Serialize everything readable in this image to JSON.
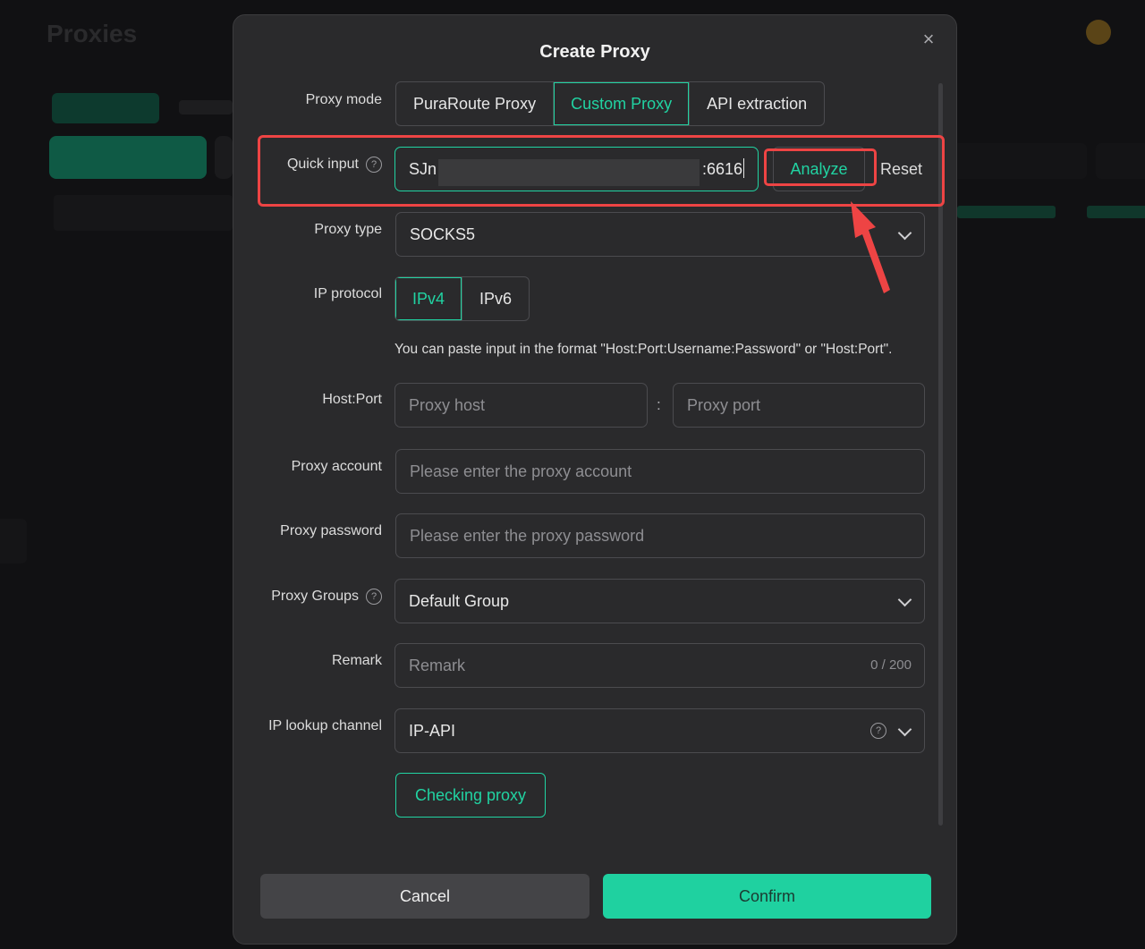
{
  "background": {
    "page_title": "Proxies"
  },
  "dialog": {
    "title": "Create Proxy",
    "proxy_mode": {
      "label": "Proxy mode",
      "options": [
        "PuraRoute Proxy",
        "Custom Proxy",
        "API extraction"
      ],
      "selected": "Custom Proxy"
    },
    "quick_input": {
      "label": "Quick input",
      "value_start": "SJn",
      "value_end": ":6616",
      "analyze_label": "Analyze",
      "reset_label": "Reset"
    },
    "proxy_type": {
      "label": "Proxy type",
      "value": "SOCKS5"
    },
    "ip_protocol": {
      "label": "IP protocol",
      "options": [
        "IPv4",
        "IPv6"
      ],
      "selected": "IPv4"
    },
    "hint": "You can paste input in the format \"Host:Port:Username:Password\" or \"Host:Port\".",
    "host_port": {
      "label": "Host:Port",
      "host_placeholder": "Proxy host",
      "separator": ":",
      "port_placeholder": "Proxy port"
    },
    "proxy_account": {
      "label": "Proxy account",
      "placeholder": "Please enter the proxy account"
    },
    "proxy_password": {
      "label": "Proxy password",
      "placeholder": "Please enter the proxy password"
    },
    "proxy_groups": {
      "label": "Proxy Groups",
      "value": "Default Group"
    },
    "remark": {
      "label": "Remark",
      "placeholder": "Remark",
      "counter": "0 / 200"
    },
    "ip_lookup": {
      "label": "IP lookup channel",
      "value": "IP-API"
    },
    "check_label": "Checking proxy",
    "cancel_label": "Cancel",
    "confirm_label": "Confirm"
  },
  "colors": {
    "accent": "#21d3a2",
    "annotation": "#ee4444",
    "dialog_bg": "#2a2a2c"
  }
}
